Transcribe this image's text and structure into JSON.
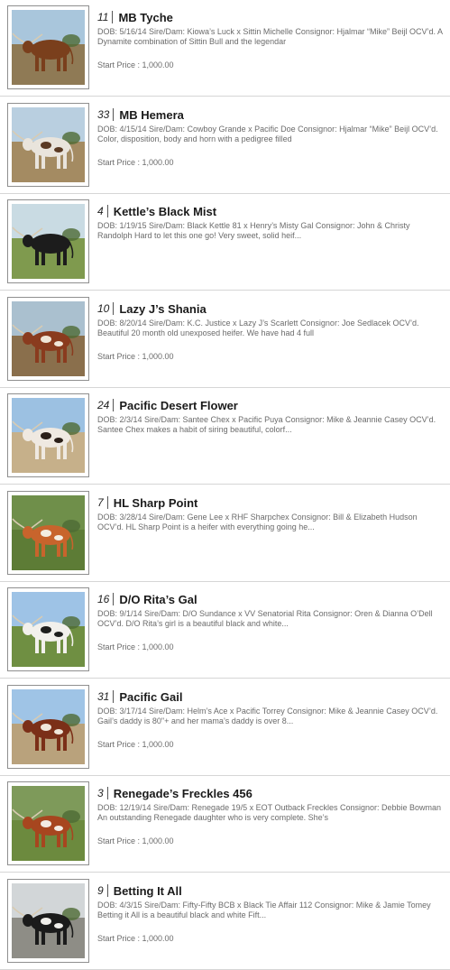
{
  "price_label": "Start Price :",
  "lots": [
    {
      "number": "11",
      "name": "MB Tyche",
      "description": "DOB: 5/16/14 Sire/Dam: Kiowa’s Luck x Sittin Michelle Consignor: Hjalmar “Mike” Beijl OCV’d. A Dynamite combination of Sittin Bull and the legendar",
      "start_price": "1,000.00",
      "photo": {
        "sky": "#a9c6dc",
        "ground": "#8f7a55",
        "animal": "#7a3f1c",
        "accent": "#7a3f1c",
        "pattern": "solid"
      }
    },
    {
      "number": "33",
      "name": "MB Hemera",
      "description": "DOB: 4/15/14 Sire/Dam: Cowboy Grande x Pacific Doe Consignor: Hjalmar “Mike” Beijl OCV’d. Color, disposition, body and horn with a pedigree filled",
      "start_price": "1,000.00",
      "photo": {
        "sky": "#b9cfe0",
        "ground": "#a48b62",
        "animal": "#e9e4dc",
        "accent": "#5a3a24",
        "pattern": "spots"
      }
    },
    {
      "number": "4",
      "name": "Kettle’s Black Mist",
      "description": "DOB: 1/19/15 Sire/Dam: Black Kettle 81 x Henry’s Misty Gal Consignor: John & Christy Randolph Hard to let this one go! Very sweet, solid heif...",
      "start_price": "",
      "photo": {
        "sky": "#c9dbe3",
        "ground": "#7f9a4e",
        "animal": "#1c1c1c",
        "accent": "#1c1c1c",
        "pattern": "solid"
      }
    },
    {
      "number": "10",
      "name": "Lazy J’s Shania",
      "description": "DOB: 8/20/14 Sire/Dam: K.C. Justice x Lazy J’s Scarlett Consignor: Joe Sedlacek OCV’d. Beautiful 20 month old unexposed heifer. We have had 4 full",
      "start_price": "1,000.00",
      "photo": {
        "sky": "#aac0cf",
        "ground": "#8a6f4c",
        "animal": "#8a3b1e",
        "accent": "#f0e6d8",
        "pattern": "spots"
      }
    },
    {
      "number": "24",
      "name": "Pacific Desert Flower",
      "description": "DOB: 2/3/14 Sire/Dam: Santee Chex x Pacific Puya Consignor: Mike & Jeannie Casey OCV’d. Santee Chex makes a habit of siring beautiful, colorf...",
      "start_price": "",
      "photo": {
        "sky": "#9cc1e2",
        "ground": "#c6b08a",
        "animal": "#efe9e1",
        "accent": "#2b1f18",
        "pattern": "spots"
      }
    },
    {
      "number": "7",
      "name": "HL Sharp Point",
      "description": "DOB: 3/28/14 Sire/Dam: Gene Lee x RHF Sharpchex Consignor: Bill & Elizabeth Hudson OCV’d. HL Sharp Point is a heifer with everything going he...",
      "start_price": "",
      "photo": {
        "sky": "#6f8f4a",
        "ground": "#5d7c36",
        "animal": "#c8642c",
        "accent": "#f3ede2",
        "pattern": "spots"
      }
    },
    {
      "number": "16",
      "name": "D/O Rita’s Gal",
      "description": "DOB: 9/1/14 Sire/Dam: D/O Sundance x VV Senatorial Rita Consignor: Oren & Dianna O’Dell OCV’d. D/O Rita’s girl is a beautiful black and white...",
      "start_price": "1,000.00",
      "photo": {
        "sky": "#9ec3e6",
        "ground": "#6f8f42",
        "animal": "#f2f0ec",
        "accent": "#1e1e1e",
        "pattern": "spots"
      }
    },
    {
      "number": "31",
      "name": "Pacific Gail",
      "description": "DOB: 3/17/14 Sire/Dam: Helm’s Ace x Pacific Torrey Consignor: Mike & Jeannie Casey OCV’d. Gail’s daddy is 80\"+ and her mama’s daddy is over 8...",
      "start_price": "1,000.00",
      "photo": {
        "sky": "#9fc4e6",
        "ground": "#b9a27c",
        "animal": "#7b2f18",
        "accent": "#efe6da",
        "pattern": "spots"
      }
    },
    {
      "number": "3",
      "name": "Renegade’s Freckles 456",
      "description": "DOB: 12/19/14 Sire/Dam: Renegade 19/5 x EOT Outback Freckles Consignor: Debbie Bowman An outstanding Renegade daughter who is very complete. She’s",
      "start_price": "1,000.00",
      "photo": {
        "sky": "#7e9a5a",
        "ground": "#6c8a3e",
        "animal": "#a7461f",
        "accent": "#f2ece4",
        "pattern": "spots"
      }
    },
    {
      "number": "9",
      "name": "Betting It All",
      "description": "DOB: 4/3/15 Sire/Dam: Fifty-Fifty BCB x Black Tie Affair 112 Consignor: Mike & Jamie Tomey Betting it All is a beautiful black and white Fift...",
      "start_price": "1,000.00",
      "photo": {
        "sky": "#d2d6d8",
        "ground": "#8e8d86",
        "animal": "#1b1b1b",
        "accent": "#f0efeb",
        "pattern": "spots"
      }
    }
  ]
}
